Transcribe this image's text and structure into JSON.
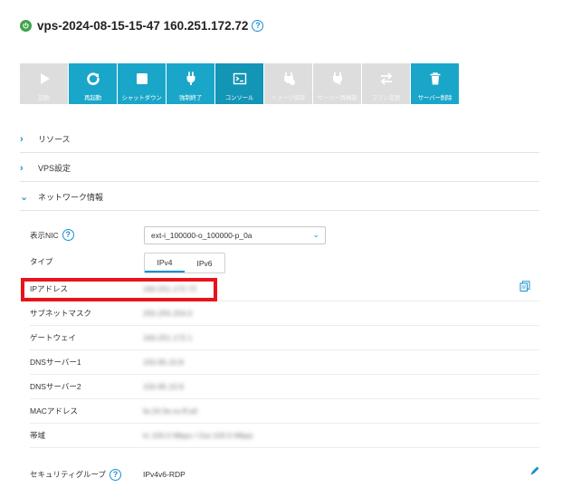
{
  "header": {
    "title": "vps-2024-08-15-15-47 160.251.172.72",
    "help": "?"
  },
  "toolbar": [
    {
      "label": "起動",
      "icon": "play-icon",
      "state": "disabled"
    },
    {
      "label": "再起動",
      "icon": "restart-icon",
      "state": "active"
    },
    {
      "label": "シャットダウン",
      "icon": "stop-icon",
      "state": "active"
    },
    {
      "label": "強制終了",
      "icon": "plug-icon",
      "state": "active"
    },
    {
      "label": "コンソール",
      "icon": "console-icon",
      "state": "current"
    },
    {
      "label": "イメージ保存",
      "icon": "save-image-icon",
      "state": "disabled"
    },
    {
      "label": "サーバー再構築",
      "icon": "rebuild-icon",
      "state": "disabled"
    },
    {
      "label": "プラン変更",
      "icon": "swap-icon",
      "state": "disabled"
    },
    {
      "label": "サーバー削除",
      "icon": "trash-icon",
      "state": "active"
    }
  ],
  "sections": {
    "resources": {
      "label": "リソース",
      "chevron": "›"
    },
    "vps_settings": {
      "label": "VPS設定",
      "chevron": "›"
    },
    "network_info": {
      "label": "ネットワーク情報",
      "chevron": "⌄"
    }
  },
  "network": {
    "nic": {
      "label": "表示NIC",
      "help": "?",
      "value": "ext-i_100000-o_100000-p_0a",
      "dropdown": "⌄"
    },
    "type": {
      "label": "タイプ",
      "tabs": [
        "IPv4",
        "IPv6"
      ],
      "selected": "IPv4"
    },
    "rows": [
      {
        "label": "IPアドレス",
        "value": "160.251.172.72"
      },
      {
        "label": "サブネットマスク",
        "value": "255.255.254.0"
      },
      {
        "label": "ゲートウェイ",
        "value": "160.251.172.1"
      },
      {
        "label": "DNSサーバー1",
        "value": "150.95.10.8"
      },
      {
        "label": "DNSサーバー2",
        "value": "150.95.10.9"
      },
      {
        "label": "MACアドレス",
        "value": "fa:16:3e:xx:ff:a0"
      },
      {
        "label": "帯域",
        "value": "In 100.0 Mbps / Out 100.0 Mbps"
      }
    ],
    "security_group": {
      "label": "セキュリティグループ",
      "help": "?",
      "value": "IPv4v6-RDP"
    }
  },
  "colors": {
    "accent": "#1aa6c9",
    "accent_dark": "#1395b6",
    "disabled": "#dddddd",
    "highlight": "#e8141b",
    "power": "#3fa34d"
  }
}
